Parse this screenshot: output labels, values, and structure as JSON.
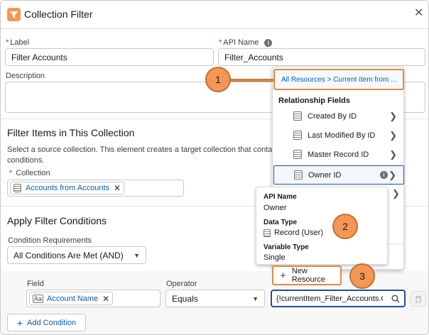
{
  "header": {
    "title": "Collection Filter",
    "close_glyph": "✕"
  },
  "form": {
    "label_label": "Label",
    "label_value": "Filter Accounts",
    "api_name_label": "API Name",
    "api_name_value": "Filter_Accounts",
    "description_label": "Description",
    "filter_items_title": "Filter Items in This Collection",
    "filter_items_help": "Select a source collection. This element creates a target collection that contains items from the source collection that meet the conditions.",
    "filter_items_help_visible": "Select a source collection. This element creates a target collection that contain",
    "filter_items_help_wrap": "conditions.",
    "collection_label": "Collection",
    "collection_value": "Accounts from Accounts",
    "apply_title": "Apply Filter Conditions",
    "condition_req_label": "Condition Requirements",
    "condition_req_value": "All Conditions Are Met (AND)",
    "field_label": "Field",
    "field_value": "Account Name",
    "field_icon_text": "Aa",
    "operator_label": "Operator",
    "operator_value": "Equals",
    "value_value": "{!currentItem_Filter_Accounts.O",
    "add_condition": "Add Condition"
  },
  "resource_picker": {
    "breadcrumb": "All Resources > Current Item from ...",
    "group_label": "Relationship Fields",
    "items": [
      {
        "label": "Created By ID"
      },
      {
        "label": "Last Modified By ID"
      },
      {
        "label": "Master Record ID"
      },
      {
        "label": "Owner ID"
      }
    ],
    "new_resource": "New Resource"
  },
  "tooltip": {
    "api_name_key": "API Name",
    "api_name_val": "Owner",
    "data_type_key": "Data Type",
    "data_type_val": "Record (User)",
    "variable_type_key": "Variable Type",
    "variable_type_val": "Single"
  },
  "callouts": [
    "1",
    "2",
    "3"
  ],
  "colors": {
    "accent": "#f49756",
    "link": "#0b5cab",
    "focus_border": "#1b5297"
  }
}
